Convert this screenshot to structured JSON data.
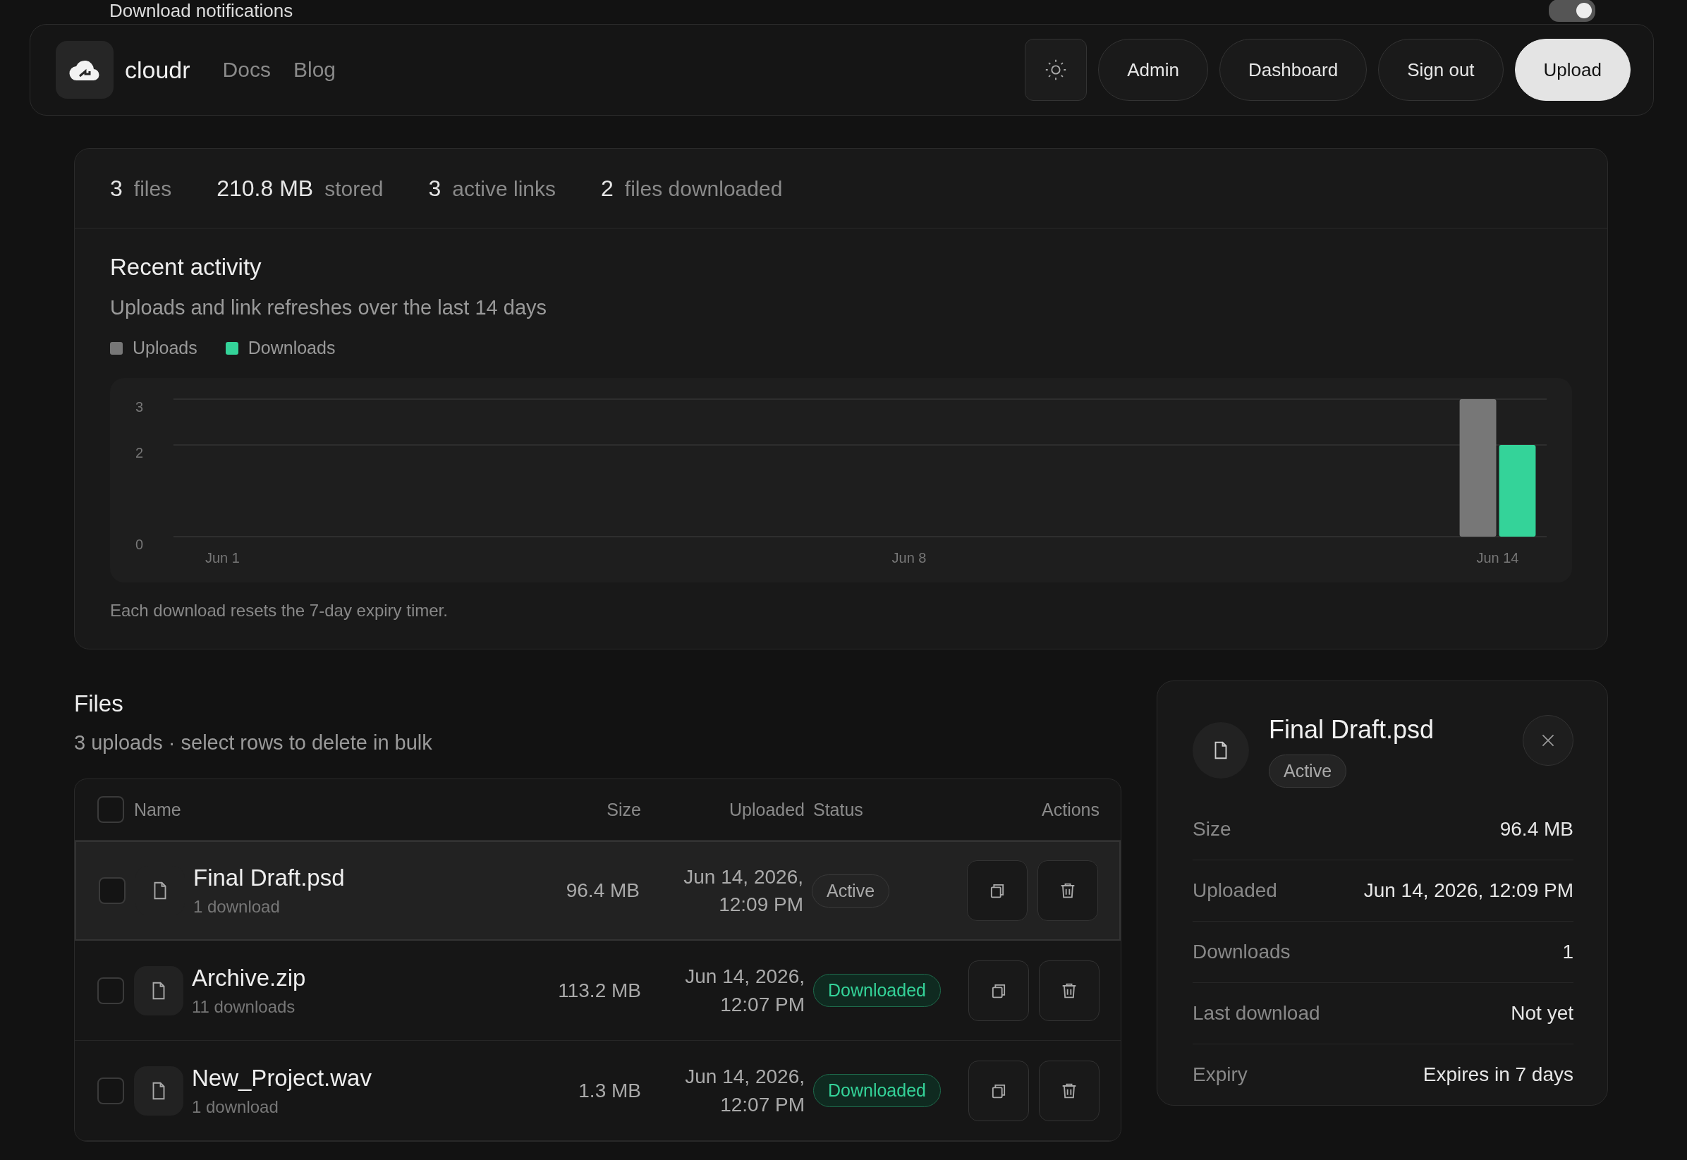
{
  "notifications": {
    "title": "Download notifications",
    "on": true
  },
  "header": {
    "brand": "cloudr",
    "nav": [
      "Docs",
      "Blog"
    ],
    "buttons": [
      {
        "label": "Admin",
        "primary": false
      },
      {
        "label": "Dashboard",
        "primary": false
      },
      {
        "label": "Sign out",
        "primary": false
      },
      {
        "label": "Upload",
        "primary": true
      }
    ]
  },
  "stats": [
    {
      "value": "3",
      "label": "files"
    },
    {
      "value": "210.8 MB",
      "label": "stored"
    },
    {
      "value": "3",
      "label": "active links"
    },
    {
      "value": "2",
      "label": "files downloaded"
    }
  ],
  "activity": {
    "title": "Recent activity",
    "subtitle": "Uploads and link refreshes over the last 14 days",
    "chart_data": {
      "type": "bar",
      "categories": [
        "Jun 1",
        null,
        null,
        null,
        null,
        null,
        null,
        "Jun 8",
        null,
        null,
        null,
        null,
        null,
        "Jun 14"
      ],
      "series": [
        {
          "name": "Uploads",
          "color": "#777777",
          "values": [
            0,
            0,
            0,
            0,
            0,
            0,
            0,
            0,
            0,
            0,
            0,
            0,
            0,
            3
          ]
        },
        {
          "name": "Downloads",
          "color": "#34d399",
          "values": [
            0,
            0,
            0,
            0,
            0,
            0,
            0,
            0,
            0,
            0,
            0,
            0,
            0,
            2
          ]
        }
      ],
      "ylim": [
        0,
        3
      ],
      "yticks": [
        0,
        2,
        3
      ]
    },
    "note": "Each download resets the 7-day expiry timer."
  },
  "files": {
    "title": "Files",
    "subtitle": "3 uploads · select rows to delete in bulk",
    "all_checked": false,
    "columns": [
      "Name",
      "Size",
      "Uploaded",
      "Status",
      "Actions"
    ],
    "rows": [
      {
        "name": "Final Draft.psd",
        "downloads": "1 download",
        "size": "96.4 MB",
        "date": "Jun 14, 2026,",
        "time": "12:09 PM",
        "status": "Active",
        "kind": "active",
        "checked": false,
        "selected": true
      },
      {
        "name": "Archive.zip",
        "downloads": "11 downloads",
        "size": "113.2 MB",
        "date": "Jun 14, 2026,",
        "time": "12:07 PM",
        "status": "Downloaded",
        "kind": "downloaded",
        "checked": false,
        "selected": false
      },
      {
        "name": "New_Project.wav",
        "downloads": "1 download",
        "size": "1.3 MB",
        "date": "Jun 14, 2026,",
        "time": "12:07 PM",
        "status": "Downloaded",
        "kind": "downloaded",
        "checked": false,
        "selected": false
      }
    ]
  },
  "details": {
    "name": "Final Draft.psd",
    "status": "Active",
    "kind": "active",
    "rows": [
      {
        "label": "Size",
        "value": "96.4 MB"
      },
      {
        "label": "Uploaded",
        "value": "Jun 14, 2026, 12:09 PM"
      },
      {
        "label": "Downloads",
        "value": "1"
      },
      {
        "label": "Last download",
        "value": "Not yet"
      },
      {
        "label": "Expiry",
        "value": "Expires in 7 days"
      }
    ]
  }
}
